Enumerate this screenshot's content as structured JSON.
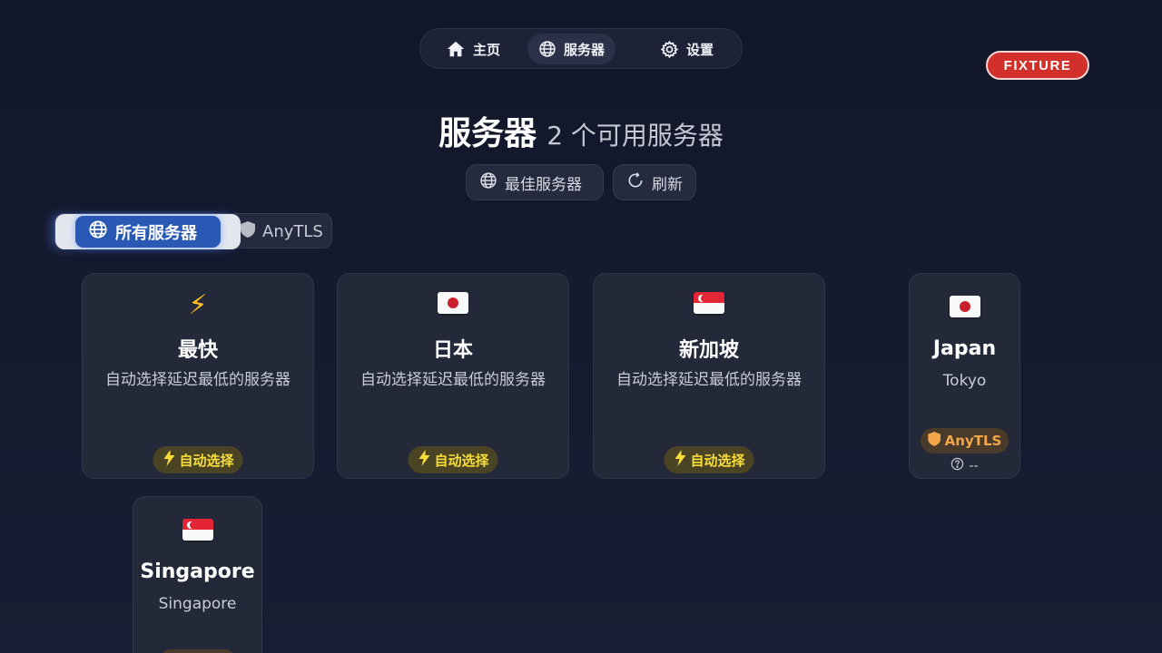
{
  "nav": {
    "items": [
      {
        "label": "主页",
        "icon": "home-icon"
      },
      {
        "label": "服务器",
        "icon": "globe-icon",
        "active": true
      },
      {
        "label": "设置",
        "icon": "gear-icon"
      }
    ]
  },
  "badge": {
    "label": "FIXTURE",
    "color": "#d2302b"
  },
  "header": {
    "title": "服务器",
    "subtitle": "2 个可用服务器",
    "best_button": "最佳服务器",
    "refresh_button": "刷新"
  },
  "filters": {
    "all_label": "所有服务器",
    "anytls_label": "AnyTLS",
    "active": "所有服务器"
  },
  "groups": [
    {
      "icon": "lightning-icon",
      "name": "最快",
      "desc": "自动选择延迟最低的服务器",
      "badge": "自动选择"
    },
    {
      "icon": "japan-flag-icon",
      "name": "日本",
      "desc": "自动选择延迟最低的服务器",
      "badge": "自动选择"
    },
    {
      "icon": "singapore-flag-icon",
      "name": "新加坡",
      "desc": "自动选择延迟最低的服务器",
      "badge": "自动选择"
    }
  ],
  "nodes": [
    {
      "icon": "japan-flag-icon",
      "name": "Japan",
      "location": "Tokyo",
      "protocol": "AnyTLS",
      "latency": "--"
    },
    {
      "icon": "singapore-flag-icon",
      "name": "Singapore",
      "location": "Singapore"
    }
  ],
  "colors": {
    "accent": "#2a58b5",
    "auto_badge_text": "#f7dd3a",
    "protocol_badge_text": "#f2a649"
  }
}
